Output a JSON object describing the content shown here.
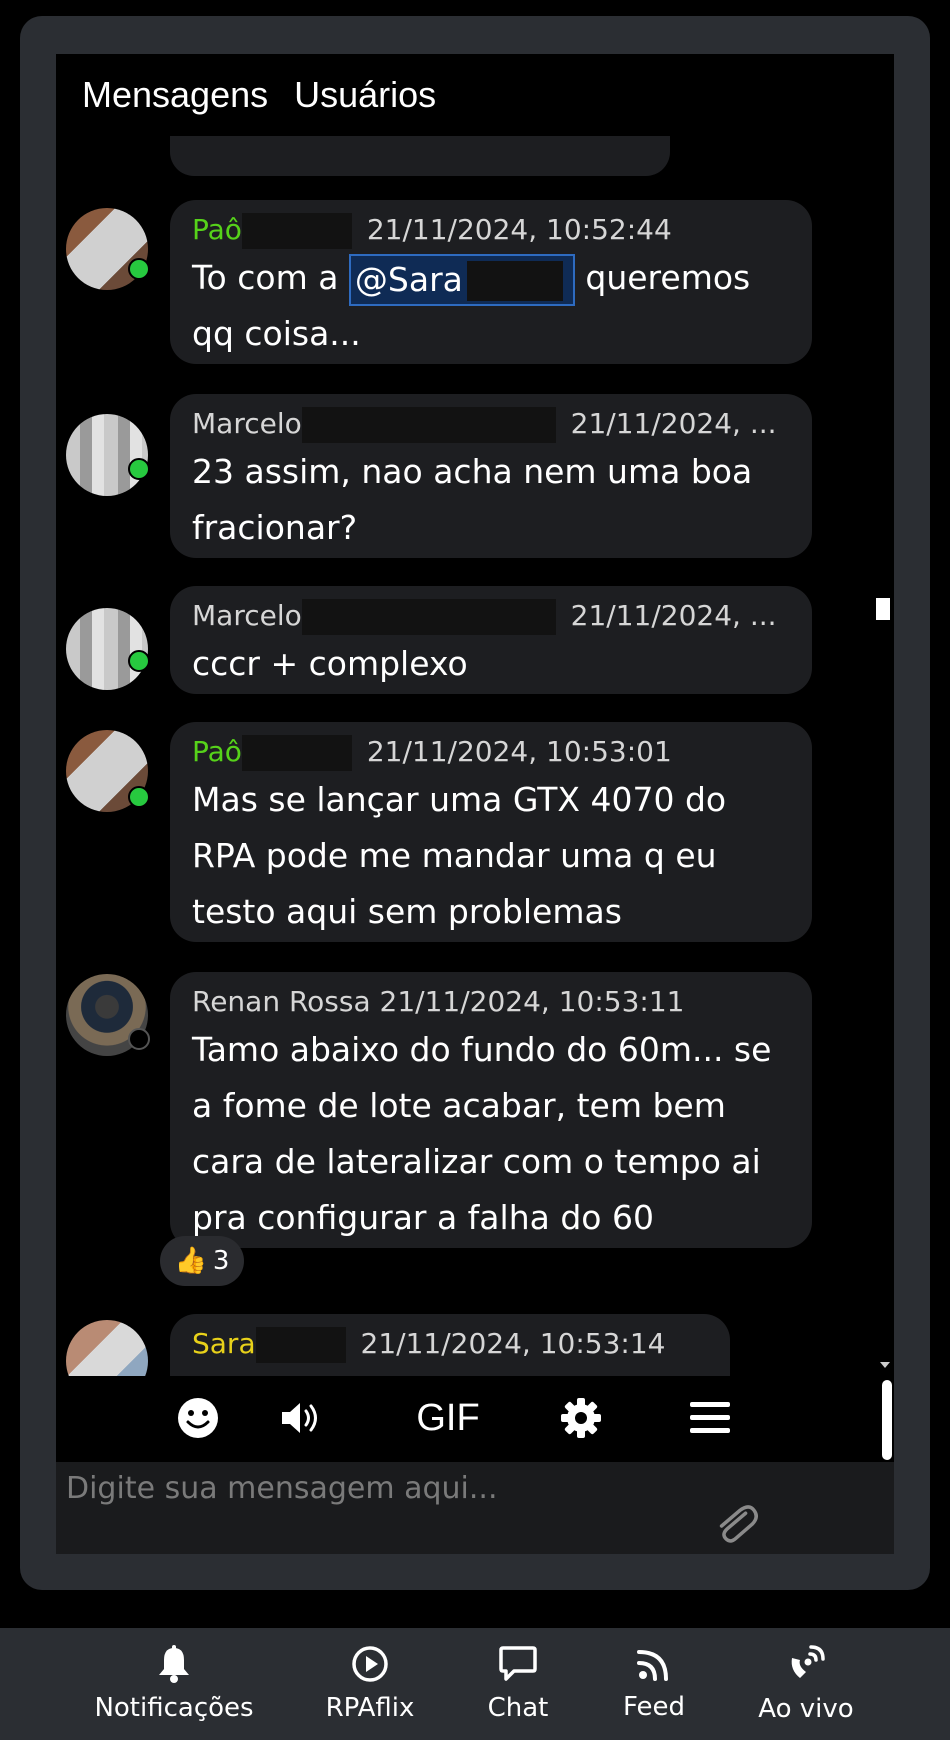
{
  "tabs": [
    "Mensagens",
    "Usuários"
  ],
  "messages": [
    {
      "name": "Paô",
      "time": "21/11/2024, 10:52:44",
      "text_before": "To com a ",
      "mention": "@Sara",
      "text_after": " queremos qq coisa..."
    },
    {
      "name": "Marcelo",
      "time": "21/11/2024, ...",
      "text": "23 assim, nao acha nem uma boa fracionar?"
    },
    {
      "name": "Marcelo",
      "time": "21/11/2024, ...",
      "text": "cccr + complexo"
    },
    {
      "name": "Paô",
      "time": "21/11/2024, 10:53:01",
      "text": "Mas se lançar uma GTX 4070 do RPA pode me mandar uma q eu testo aqui sem problemas"
    },
    {
      "name": "Renan Rossa",
      "time": "21/11/2024, 10:53:11",
      "text": "Tamo abaixo do fundo do 60m... se a fome de lote acabar, tem bem cara de lateralizar com o tempo ai pra configurar a falha do 60",
      "reaction_count": "3"
    },
    {
      "name": "Sara",
      "time": "21/11/2024, 10:53:14"
    }
  ],
  "toolbar": {
    "gif": "GIF"
  },
  "composer": {
    "placeholder": "Digite sua mensagem aqui..."
  },
  "nav": [
    {
      "label": "Notificações",
      "icon": "bell-icon"
    },
    {
      "label": "RPAflix",
      "icon": "play-circle-icon"
    },
    {
      "label": "Chat",
      "icon": "chat-bubble-icon"
    },
    {
      "label": "Feed",
      "icon": "rss-icon"
    },
    {
      "label": "Ao vivo",
      "icon": "broadcast-icon"
    }
  ],
  "colors": {
    "online": "#27c93f",
    "name_green": "#56d21a",
    "name_yellow": "#e8d11a",
    "bubble": "#1d1e21",
    "panel": "#2b2e33"
  }
}
